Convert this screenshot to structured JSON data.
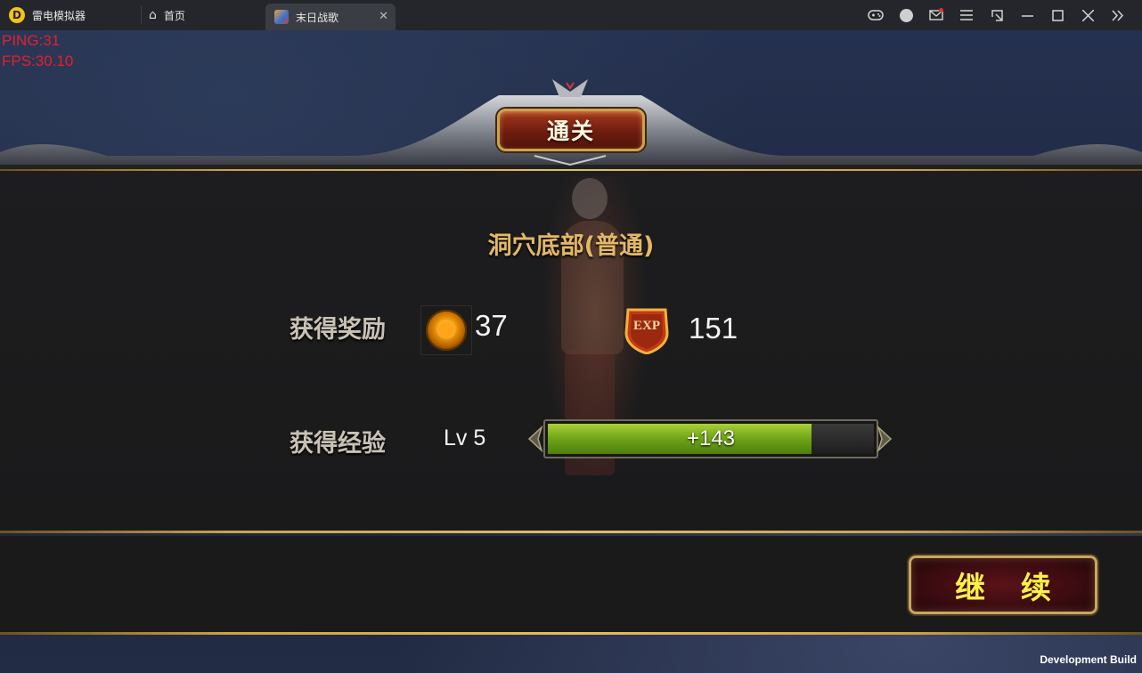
{
  "emulator": {
    "app_name": "雷电模拟器",
    "logo_glyph": "D",
    "home_tab": "首页",
    "game_tab": "末日战歌",
    "close_glyph": "✕",
    "controls": [
      "gamepad-icon",
      "avatar-icon",
      "mail-icon",
      "menu-icon",
      "resize-icon",
      "minimize-icon",
      "maximize-icon",
      "close-icon",
      "collapse-icon"
    ]
  },
  "debug": {
    "ping": "PING:31",
    "fps": "FPS:30.10"
  },
  "result": {
    "title": "通关",
    "stage_name": "洞穴底部(普通)",
    "reward_label": "获得奖励",
    "gold_amount": "37",
    "exp_badge_text": "EXP",
    "exp_amount": "151",
    "exp_label": "获得经验",
    "level": "Lv 5",
    "exp_gain": "+143",
    "exp_progress_fraction": 0.81
  },
  "continue_label": "继 续",
  "dev_build": "Development Build",
  "colors": {
    "gold_accent": "#c9a24a",
    "stage_name": "#e3b865",
    "exp_bar": "#6ea417",
    "continue_text": "#fff04a",
    "debug_text": "#e4202a"
  }
}
